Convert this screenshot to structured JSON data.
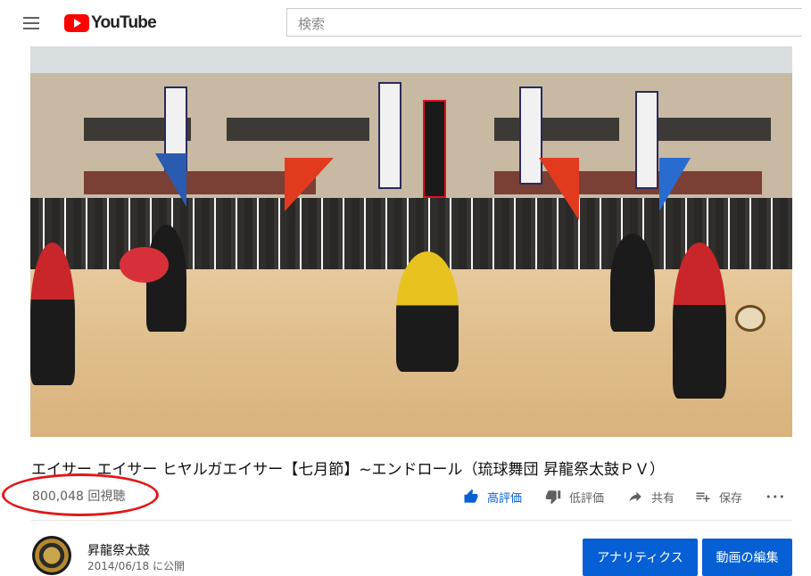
{
  "header": {
    "logo_text": "YouTube",
    "search_placeholder": "検索"
  },
  "video": {
    "title": "エイサー エイサー ヒヤルガエイサー【七月節】~エンドロール（琉球舞団 昇龍祭太鼓ＰＶ）",
    "views": "800,048 回視聴"
  },
  "actions": {
    "like_label": "高評価",
    "dislike_label": "低評価",
    "share_label": "共有",
    "save_label": "保存",
    "more_label": "•••"
  },
  "channel": {
    "name": "昇龍祭太鼓",
    "published": "2014/06/18 に公開"
  },
  "buttons": {
    "analytics_label": "アナリティクス",
    "edit_video_label": "動画の編集"
  },
  "colors": {
    "accent_blue": "#065fd4",
    "brand_red": "#ff0000",
    "annotation_red": "#e2181a"
  },
  "icons": [
    "menu-icon",
    "youtube-logo-icon",
    "thumb-up-icon",
    "thumb-down-icon",
    "share-icon",
    "save-playlist-icon",
    "more-icon"
  ]
}
